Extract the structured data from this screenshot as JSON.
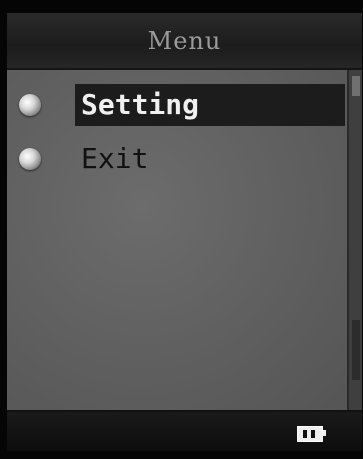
{
  "title": "Menu",
  "menu": {
    "items": [
      {
        "label": "Setting",
        "selected": true
      },
      {
        "label": "Exit",
        "selected": false
      }
    ]
  },
  "status": {
    "battery_icon": "battery-icon"
  }
}
